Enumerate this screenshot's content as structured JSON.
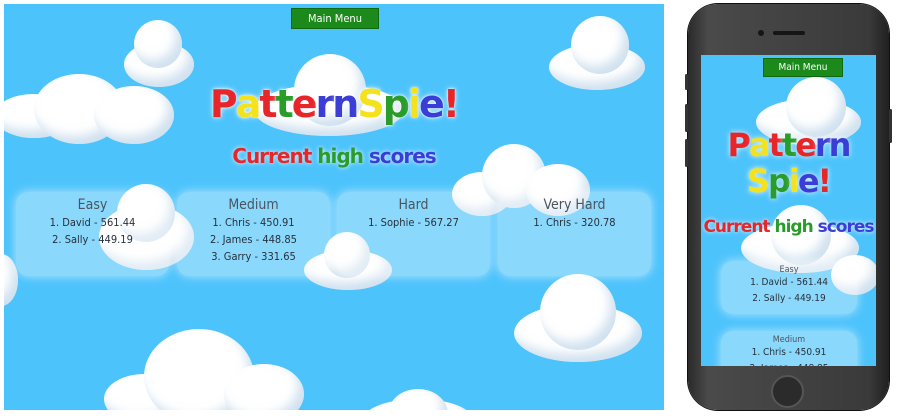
{
  "main_menu": {
    "label": "Main Menu"
  },
  "logo": {
    "letters": [
      {
        "ch": "P",
        "color": "#e8262a"
      },
      {
        "ch": "a",
        "color": "#f4e21c"
      },
      {
        "ch": "t",
        "color": "#e8262a"
      },
      {
        "ch": "t",
        "color": "#2a9c2a"
      },
      {
        "ch": "e",
        "color": "#e8262a"
      },
      {
        "ch": "r",
        "color": "#3b3ed6"
      },
      {
        "ch": "n",
        "color": "#3b3ed6"
      },
      {
        "ch": "S",
        "color": "#f4e21c"
      },
      {
        "ch": "p",
        "color": "#2a9c2a"
      },
      {
        "ch": "i",
        "color": "#f4e21c"
      },
      {
        "ch": "e",
        "color": "#3b3ed6"
      },
      {
        "ch": "!",
        "color": "#e8262a"
      }
    ]
  },
  "subtitle": {
    "word1": "Current",
    "word1_color": "#e8262a",
    "word2": "high",
    "word2_color": "#2a9c2a",
    "word3": "scores",
    "word3_color": "#3b3ed6"
  },
  "scores": [
    {
      "difficulty": "Easy",
      "entries": [
        "1. David - 561.44",
        "2. Sally - 449.19"
      ]
    },
    {
      "difficulty": "Medium",
      "entries": [
        "1. Chris - 450.91",
        "2. James - 448.85",
        "3. Garry - 331.65"
      ]
    },
    {
      "difficulty": "Hard",
      "entries": [
        "1. Sophie - 567.27"
      ]
    },
    {
      "difficulty": "Very Hard",
      "entries": [
        "1. Chris - 320.78"
      ]
    }
  ],
  "colors": {
    "sky": "#4dc3fc",
    "menu_green": "#1b8a1b"
  }
}
